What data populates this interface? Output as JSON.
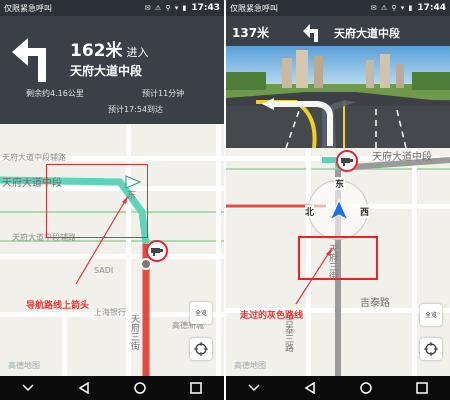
{
  "left": {
    "status": {
      "carrier": "仅限紧急呼叫",
      "time": "17:43"
    },
    "nav": {
      "distance": "162米",
      "enter": "进入",
      "road": "天府大道中段",
      "remaining": "剩余约4.16公里",
      "eta_minutes": "预计11分钟",
      "eta_time": "预计17:54到达"
    },
    "map": {
      "label_top": "天府大道中段辅路",
      "label_mid": "天府大道中段",
      "label_lower": "天府大道中段辅路",
      "label_poi1": "SADI",
      "label_poi2": "上海银行",
      "label_poi3": "高德新城",
      "label_road_v": "天府三街",
      "annotation": "导航路线上箭头",
      "overview_btn": "全览",
      "logo": "高德地图"
    }
  },
  "right": {
    "status": {
      "carrier": "仅限紧急呼叫",
      "time": "17:44"
    },
    "nav": {
      "distance": "137米",
      "road": "天府大道中段"
    },
    "map": {
      "label_top": "天府大道中段",
      "label_mid": "吉泰路",
      "label_v1": "东",
      "label_v2": "天府三街",
      "label_v3": "吉泰三路",
      "compass_n": "东",
      "compass_e": "西",
      "compass_w": "北",
      "annotation": "走过的灰色路线",
      "overview_btn": "全览",
      "logo": "高德地图"
    }
  },
  "colors": {
    "route_green": "#5ed3b9",
    "route_red": "#e8493f",
    "route_gray": "#9a9a9a",
    "nav_panel": "#3a4046",
    "annotation_red": "#e33333",
    "compass_blue": "#1a6ff0"
  }
}
